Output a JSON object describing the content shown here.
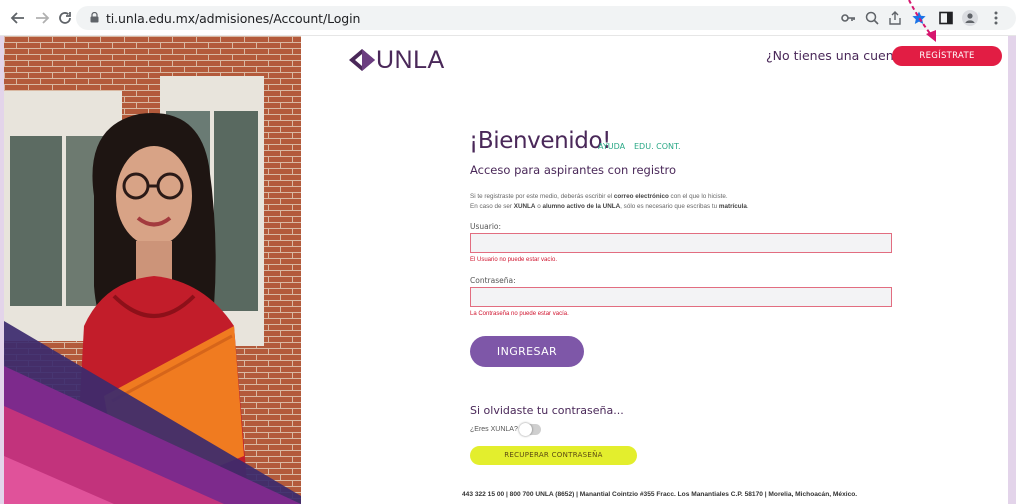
{
  "browser": {
    "url": "ti.unla.edu.mx/admisiones/Account/Login",
    "back_icon": "arrow-left-icon",
    "forward_icon": "arrow-right-icon",
    "reload_icon": "reload-icon",
    "toolbar_icons": [
      "key-icon",
      "zoom-icon",
      "share-icon",
      "star-icon",
      "sidepanel-icon",
      "profile-icon",
      "kebab-menu-icon"
    ]
  },
  "header": {
    "logo_text": "UNLA",
    "no_account": "¿No tienes una cuenta?",
    "register_button": "REGÍSTRATE"
  },
  "login": {
    "title": "¡Bienvenido!",
    "link_help": "AYUDA",
    "link_edu": "EDU. CONT.",
    "subtitle": "Acceso para aspirantes con registro",
    "info_line1_a": "Si te registraste por este medio, deberás escribir el ",
    "info_line1_b": "correo electrónico",
    "info_line1_c": " con el que lo hiciste.",
    "info_line2_a": "En caso de ser ",
    "info_line2_b": "XUNLA",
    "info_line2_c": " o ",
    "info_line2_d": "alumno activo de la UNLA",
    "info_line2_e": ", sólo es necesario que escribas tu ",
    "info_line2_f": "matrícula",
    "info_line2_g": ".",
    "user_label": "Usuario:",
    "user_value": "",
    "user_error": "El Usuario no puede estar vacío.",
    "password_label": "Contraseña:",
    "password_value": "",
    "password_error": "La Contraseña no puede estar vacía.",
    "submit_button": "INGRESAR"
  },
  "recover": {
    "title": "Si olvidaste tu contraseña...",
    "toggle_label": "¿Eres XUNLA?",
    "toggle_on": false,
    "button": "RECUPERAR CONTRASEÑA"
  },
  "footer": {
    "text": "443 322 15 00 | 800 700 UNLA (8652) | Manantial Cointzio #355 Fracc. Los Manantiales C.P. 58170 | Morelia, Michoacán, México."
  },
  "colors": {
    "brand_purple": "#4a2859",
    "register_red": "#e21d44",
    "submit_purple": "#7e57a8",
    "recover_yellow": "#e3ee2d",
    "link_green": "#2aa886",
    "error_red": "#d0142e",
    "annotation_magenta": "#d6166e"
  }
}
